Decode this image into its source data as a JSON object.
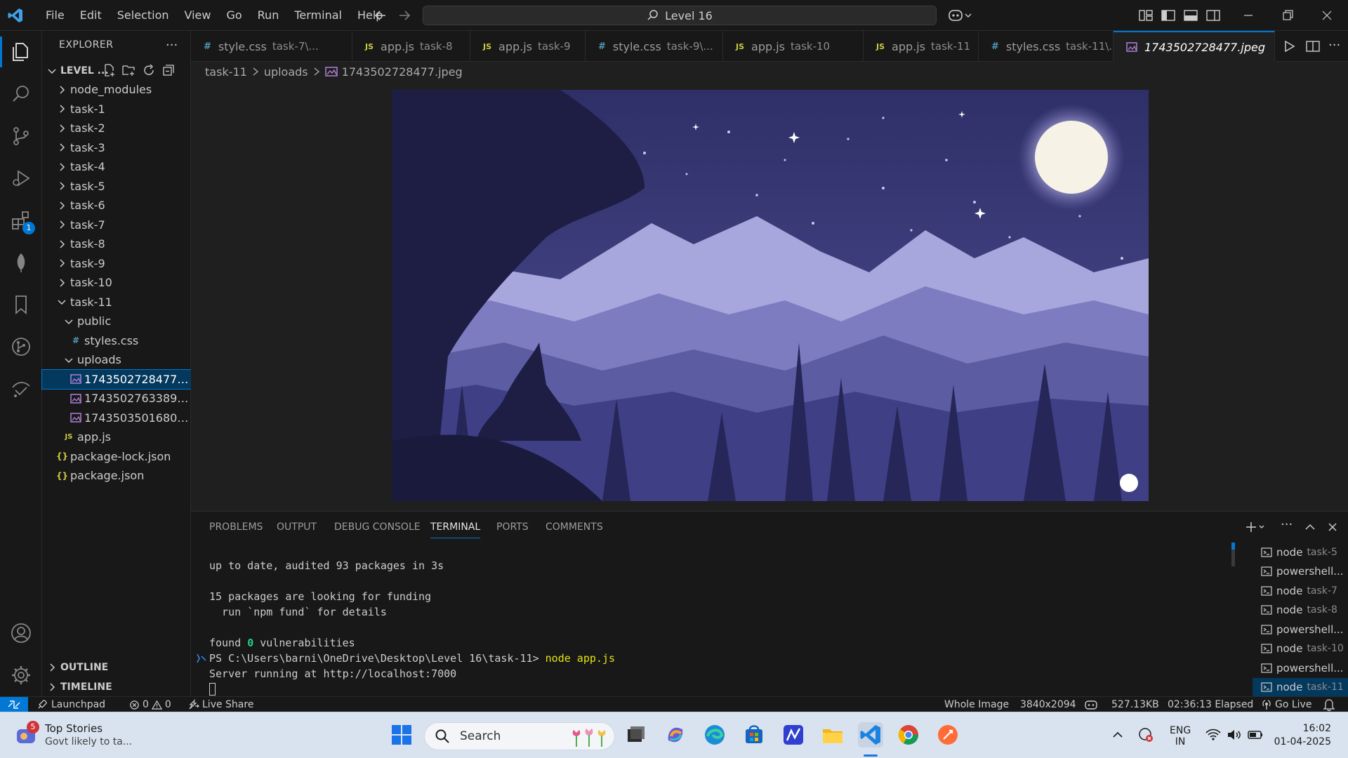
{
  "titlebar": {
    "menu": [
      "File",
      "Edit",
      "Selection",
      "View",
      "Go",
      "Run",
      "Terminal",
      "Help"
    ],
    "search_text": "Level 16"
  },
  "explorer": {
    "title": "EXPLORER",
    "root": "LEVEL ...",
    "tree": [
      {
        "label": "node_modules",
        "kind": "folder"
      },
      {
        "label": "task-1",
        "kind": "folder"
      },
      {
        "label": "task-2",
        "kind": "folder"
      },
      {
        "label": "task-3",
        "kind": "folder"
      },
      {
        "label": "task-4",
        "kind": "folder"
      },
      {
        "label": "task-5",
        "kind": "folder"
      },
      {
        "label": "task-6",
        "kind": "folder"
      },
      {
        "label": "task-7",
        "kind": "folder"
      },
      {
        "label": "task-8",
        "kind": "folder"
      },
      {
        "label": "task-9",
        "kind": "folder"
      },
      {
        "label": "task-10",
        "kind": "folder"
      },
      {
        "label": "task-11",
        "kind": "folder-open"
      },
      {
        "label": "public",
        "kind": "folder-open"
      },
      {
        "label": "styles.css",
        "kind": "css"
      },
      {
        "label": "uploads",
        "kind": "folder-open"
      },
      {
        "label": "1743502728477.jp...",
        "kind": "image"
      },
      {
        "label": "1743502763389.jp...",
        "kind": "image"
      },
      {
        "label": "1743503501680.jp...",
        "kind": "image"
      },
      {
        "label": "app.js",
        "kind": "js"
      },
      {
        "label": "package-lock.json",
        "kind": "json"
      },
      {
        "label": "package.json",
        "kind": "json"
      }
    ],
    "outline": "OUTLINE",
    "timeline": "TIMELINE"
  },
  "activity": {
    "extensions_badge": "1"
  },
  "tabs": [
    {
      "icon": "#",
      "name": "style.css",
      "desc": "task-7\\..."
    },
    {
      "icon": "JS",
      "name": "app.js",
      "desc": "task-8"
    },
    {
      "icon": "JS",
      "name": "app.js",
      "desc": "task-9"
    },
    {
      "icon": "#",
      "name": "style.css",
      "desc": "task-9\\..."
    },
    {
      "icon": "JS",
      "name": "app.js",
      "desc": "task-10"
    },
    {
      "icon": "JS",
      "name": "app.js",
      "desc": "task-11"
    },
    {
      "icon": "#",
      "name": "styles.css",
      "desc": "task-11\\..."
    },
    {
      "icon": "img",
      "name": "1743502728477.jpeg",
      "desc": ""
    }
  ],
  "breadcrumb": {
    "parts": [
      "task-11",
      "uploads",
      "1743502728477.jpeg"
    ]
  },
  "panel": {
    "tabs": [
      "PROBLEMS",
      "OUTPUT",
      "DEBUG CONSOLE",
      "TERMINAL",
      "PORTS",
      "COMMENTS"
    ],
    "active_tab": "TERMINAL",
    "terminal_lines": [
      "up to date, audited 93 packages in 3s",
      "",
      "15 packages are looking for funding",
      "  run `npm fund` for details",
      "",
      "found ",
      "PS C:\\Users\\barni\\OneDrive\\Desktop\\Level 16\\task-11> ",
      "Server running at http://localhost:7000"
    ],
    "found_count": "0",
    "found_rest": " vulnerabilities",
    "command": "node app.js",
    "terminals": [
      {
        "name": "node",
        "desc": "task-5"
      },
      {
        "name": "powershell...",
        "desc": ""
      },
      {
        "name": "node",
        "desc": "task-7"
      },
      {
        "name": "node",
        "desc": "task-8"
      },
      {
        "name": "powershell...",
        "desc": ""
      },
      {
        "name": "node",
        "desc": "task-10"
      },
      {
        "name": "powershell...",
        "desc": ""
      },
      {
        "name": "node",
        "desc": "task-11"
      }
    ]
  },
  "statusbar": {
    "launchpad": "Launchpad",
    "errors": "0",
    "warnings": "0",
    "live_share": "Live Share",
    "zoom": "Whole Image",
    "dimensions": "3840x2094",
    "size": "527.13KB",
    "elapsed": "02:36:13 Elapsed",
    "go_live": "Go Live"
  },
  "taskbar": {
    "news_badge": "5",
    "news_title": "Top Stories",
    "news_sub": "Govt likely to ta...",
    "search": "Search",
    "lang1": "ENG",
    "lang2": "IN",
    "time": "16:02",
    "date": "01-04-2025"
  },
  "colors": {
    "accent": "#0078d4",
    "sky": "#3a3a78",
    "moon": "#f6f3e6"
  }
}
